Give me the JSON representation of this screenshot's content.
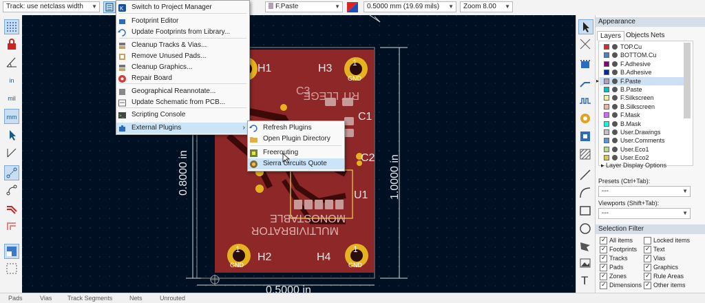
{
  "toolbar": {
    "track_width": "Track: use netclass width",
    "layer": "F.Paste",
    "grid": "0.5000 mm (19.69 mils)",
    "zoom": "Zoom 8.00"
  },
  "tools_menu": {
    "items": [
      {
        "label": "Switch to Project Manager",
        "icon": "kicad-icon"
      },
      {
        "label": "Footprint Editor",
        "icon": "footprint-icon"
      },
      {
        "label": "Update Footprints from Library...",
        "icon": "refresh-icon"
      },
      {
        "label": "Cleanup Tracks & Vias...",
        "icon": "broom-icon"
      },
      {
        "label": "Remove Unused Pads...",
        "icon": "pad-icon"
      },
      {
        "label": "Cleanup Graphics...",
        "icon": "broom-icon"
      },
      {
        "label": "Repair Board",
        "icon": "repair-icon"
      },
      {
        "label": "Geographical Reannotate...",
        "icon": "reannotate-icon"
      },
      {
        "label": "Update Schematic from PCB...",
        "icon": "schematic-icon"
      },
      {
        "label": "Scripting Console",
        "icon": "console-icon"
      },
      {
        "label": "External Plugins",
        "icon": "plugin-icon"
      }
    ]
  },
  "plugins_menu": {
    "items": [
      {
        "label": "Refresh Plugins",
        "icon": "refresh-icon"
      },
      {
        "label": "Open Plugin Directory",
        "icon": "folder-icon"
      },
      {
        "label": "Freerouting",
        "icon": "freerouting-icon"
      },
      {
        "label": "Sierra Circuits Quote",
        "icon": "sierra-icon"
      }
    ]
  },
  "board": {
    "dim_left": "0.8000 in",
    "dim_right": "1.0000 in",
    "dim_bottom": "0.5000 in",
    "h1": "H1",
    "h2": "H2",
    "h3": "H3",
    "h4": "H4",
    "pin": "1",
    "gnd": "GND",
    "c3": "C3",
    "c1": "C1",
    "c2": "C2",
    "u1": "U1",
    "silk_top": "RIT LLEGE",
    "silk_mid": "MONOSTABLE",
    "silk_bot": "MULTIVIBRATOR"
  },
  "appearance": {
    "title": "Appearance",
    "tabs": [
      "Layers",
      "Objects",
      "Nets"
    ],
    "layers": [
      {
        "name": "TOP.Cu",
        "color": "#c83232"
      },
      {
        "name": "BOTTOM.Cu",
        "color": "#4d7fc4"
      },
      {
        "name": "F.Adhesive",
        "color": "#84007f"
      },
      {
        "name": "B.Adhesive",
        "color": "#0029a3"
      },
      {
        "name": "F.Paste",
        "color": "#b4a0b4"
      },
      {
        "name": "B.Paste",
        "color": "#00c2c2"
      },
      {
        "name": "F.Silkscreen",
        "color": "#f2eda1"
      },
      {
        "name": "B.Silkscreen",
        "color": "#e8b2a7"
      },
      {
        "name": "F.Mask",
        "color": "#d864ff"
      },
      {
        "name": "B.Mask",
        "color": "#02ffee"
      },
      {
        "name": "User.Drawings",
        "color": "#c2c2c2"
      },
      {
        "name": "User.Comments",
        "color": "#5994dc"
      },
      {
        "name": "User.Eco1",
        "color": "#b4db89"
      },
      {
        "name": "User.Eco2",
        "color": "#d8c852"
      }
    ],
    "layer_display_options": "Layer Display Options",
    "presets_label": "Presets (Ctrl+Tab):",
    "presets_value": "---",
    "viewports_label": "Viewports (Shift+Tab):",
    "viewports_value": "---"
  },
  "selection_filter": {
    "title": "Selection Filter",
    "left": [
      {
        "label": "All items",
        "checked": true
      },
      {
        "label": "Footprints",
        "checked": true
      },
      {
        "label": "Tracks",
        "checked": true
      },
      {
        "label": "Pads",
        "checked": true
      },
      {
        "label": "Zones",
        "checked": true
      },
      {
        "label": "Dimensions",
        "checked": true
      }
    ],
    "right": [
      {
        "label": "Locked items",
        "checked": false
      },
      {
        "label": "Text",
        "checked": true
      },
      {
        "label": "Vias",
        "checked": true
      },
      {
        "label": "Graphics",
        "checked": true
      },
      {
        "label": "Rule Areas",
        "checked": true
      },
      {
        "label": "Other items",
        "checked": true
      }
    ]
  },
  "left_toolbar": {
    "in": "in",
    "mil": "mil",
    "mm": "mm"
  },
  "status": {
    "items": [
      "Pads",
      "Vias",
      "Track Segments",
      "Nets",
      "Unrouted"
    ]
  }
}
